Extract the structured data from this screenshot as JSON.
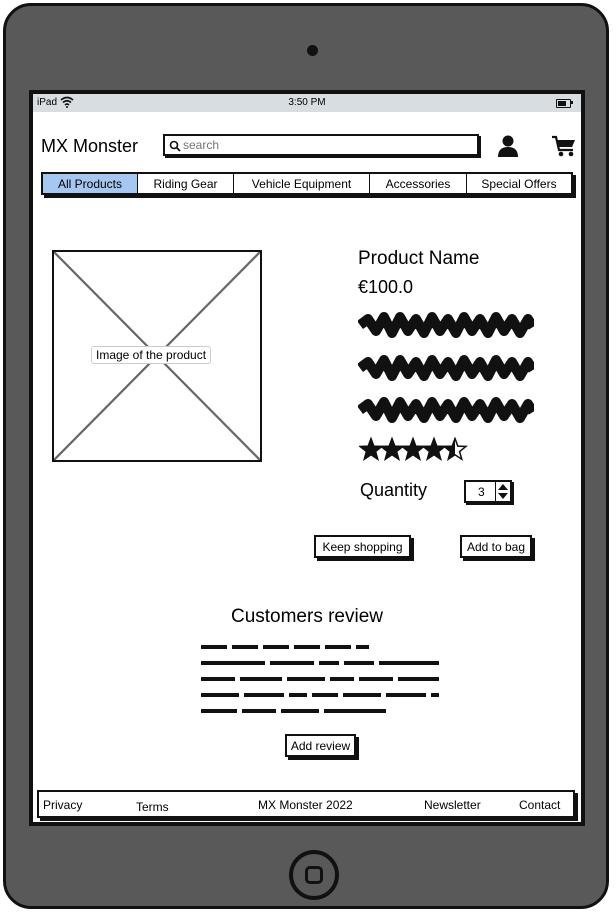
{
  "statusbar": {
    "carrier": "iPad",
    "time": "3:50 PM"
  },
  "header": {
    "brand": "MX Monster",
    "search_placeholder": "search"
  },
  "nav": {
    "tabs": [
      {
        "label": "All Products",
        "active": true
      },
      {
        "label": "Riding Gear",
        "active": false
      },
      {
        "label": "Vehicle Equipment",
        "active": false
      },
      {
        "label": "Accessories",
        "active": false
      },
      {
        "label": "Special Offers",
        "active": false
      }
    ]
  },
  "product": {
    "image_label": "Image of the product",
    "name": "Product Name",
    "price": "€100.0",
    "rating": 4.5,
    "rating_max": 5,
    "quantity_label": "Quantity",
    "quantity": "3"
  },
  "actions": {
    "keep_shopping": "Keep shopping",
    "add_to_bag": "Add to bag"
  },
  "reviews": {
    "title": "Customers review",
    "add_review": "Add review"
  },
  "footer": {
    "privacy": "Privacy",
    "terms": "Terms",
    "copyright": "MX Monster 2022",
    "newsletter": "Newsletter",
    "contact": "Contact"
  },
  "colors": {
    "active_tab": "#a6c8f0",
    "device_frame": "#595959",
    "statusbar": "#d8dde1"
  }
}
